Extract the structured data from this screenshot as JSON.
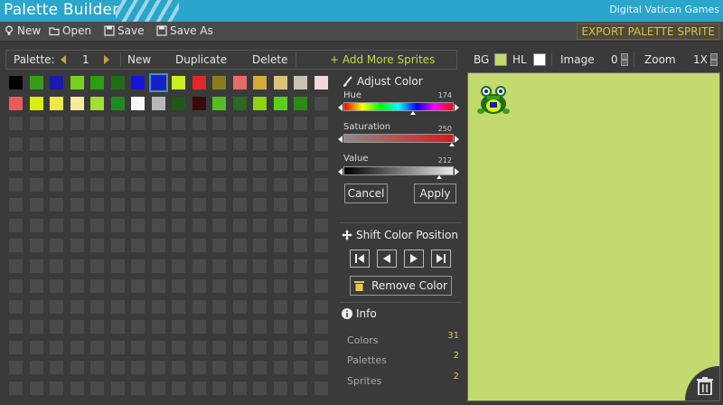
{
  "app": {
    "title": "Palette Builder",
    "brand": "Digital Vatican Games"
  },
  "menu": {
    "new": "New",
    "open": "Open",
    "save": "Save",
    "save_as": "Save As",
    "export": "EXPORT PALETTE SPRITE"
  },
  "palette_toolbar": {
    "label": "Palette:",
    "number": "1",
    "new": "New",
    "duplicate": "Duplicate",
    "delete": "Delete",
    "add_sprites": "+ Add More Sprites"
  },
  "palette_colors": [
    [
      "#000000",
      "#3a9c1a",
      "#1a1ab0",
      "#7ad21e",
      "#2d9d12",
      "#1f6e14",
      "#1515d8",
      "#1620c8",
      "#c8f020",
      "#e02828",
      "#8c7a1e",
      "#e86a6a",
      "#d4ac3a",
      "#d8c47a",
      "#c8c4b4",
      "#f4d8d8"
    ],
    [
      "#ee5a5a",
      "#d8f010",
      "#f0e84a",
      "#f4ec9a",
      "#a0e030",
      "#1f8a1f",
      "#f8f8f8",
      "#b8b8b8",
      "#1e5a14",
      "#3a0a0a",
      "#50c020",
      "#2a6a20",
      "#8ad410",
      "#5ad01a",
      "#2a8a14"
    ]
  ],
  "selected_cell": {
    "row": 0,
    "col": 7
  },
  "adjust": {
    "title": "Adjust Color",
    "hue_label": "Hue",
    "hue_value": "174",
    "sat_label": "Saturation",
    "sat_value": "250",
    "val_label": "Value",
    "val_value": "212",
    "cancel": "Cancel",
    "apply": "Apply"
  },
  "shift": {
    "title": "Shift Color Position",
    "remove": "Remove Color"
  },
  "info": {
    "title": "Info",
    "colors_label": "Colors",
    "colors_value": "31",
    "palettes_label": "Palettes",
    "palettes_value": "2",
    "sprites_label": "Sprites",
    "sprites_value": "2"
  },
  "preview": {
    "bg_label": "BG",
    "bg_color": "#c2da6e",
    "hl_label": "HL",
    "hl_color": "#ffffff",
    "image_label": "Image",
    "image_value": "0",
    "zoom_label": "Zoom",
    "zoom_value": "1X"
  },
  "colors": {
    "accent": "#2aa5cc",
    "export": "#d8c05a",
    "add": "#c8d94a",
    "info_value": "#e8c850"
  },
  "icons": [
    "bulb-icon",
    "folder-icon",
    "save-icon",
    "save-as-icon",
    "brush-icon",
    "move-icon",
    "trash-icon",
    "info-icon"
  ]
}
